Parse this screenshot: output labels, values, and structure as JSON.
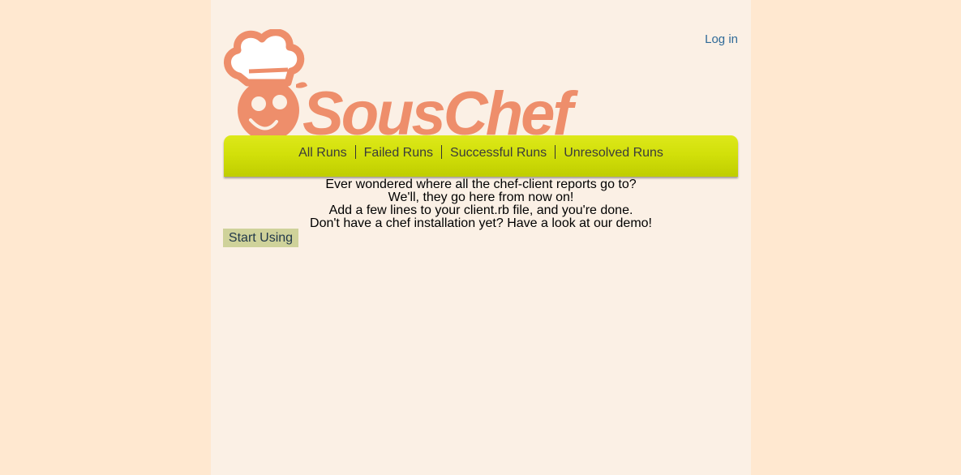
{
  "header": {
    "login_label": "Log in",
    "logo_text": "SousChef"
  },
  "nav": {
    "items": [
      {
        "label": "All Runs"
      },
      {
        "label": "Failed Runs"
      },
      {
        "label": "Successful Runs"
      },
      {
        "label": "Unresolved Runs"
      }
    ]
  },
  "intro": {
    "lines": [
      "Ever wondered where all the chef-client reports go to?",
      "We'll, they go here from now on!",
      "Add a few lines to your client.rb file, and you're done.",
      "Don't have a chef installation yet? Have a look at our demo!"
    ]
  },
  "actions": {
    "start_label": "Start Using"
  },
  "colors": {
    "page_bg": "#ffe8d0",
    "content_bg": "#fbf0e5",
    "logo": "#ee8e6b",
    "navbar": "#d2e00a",
    "link": "#2f6a98",
    "button": "#cfd29a"
  }
}
